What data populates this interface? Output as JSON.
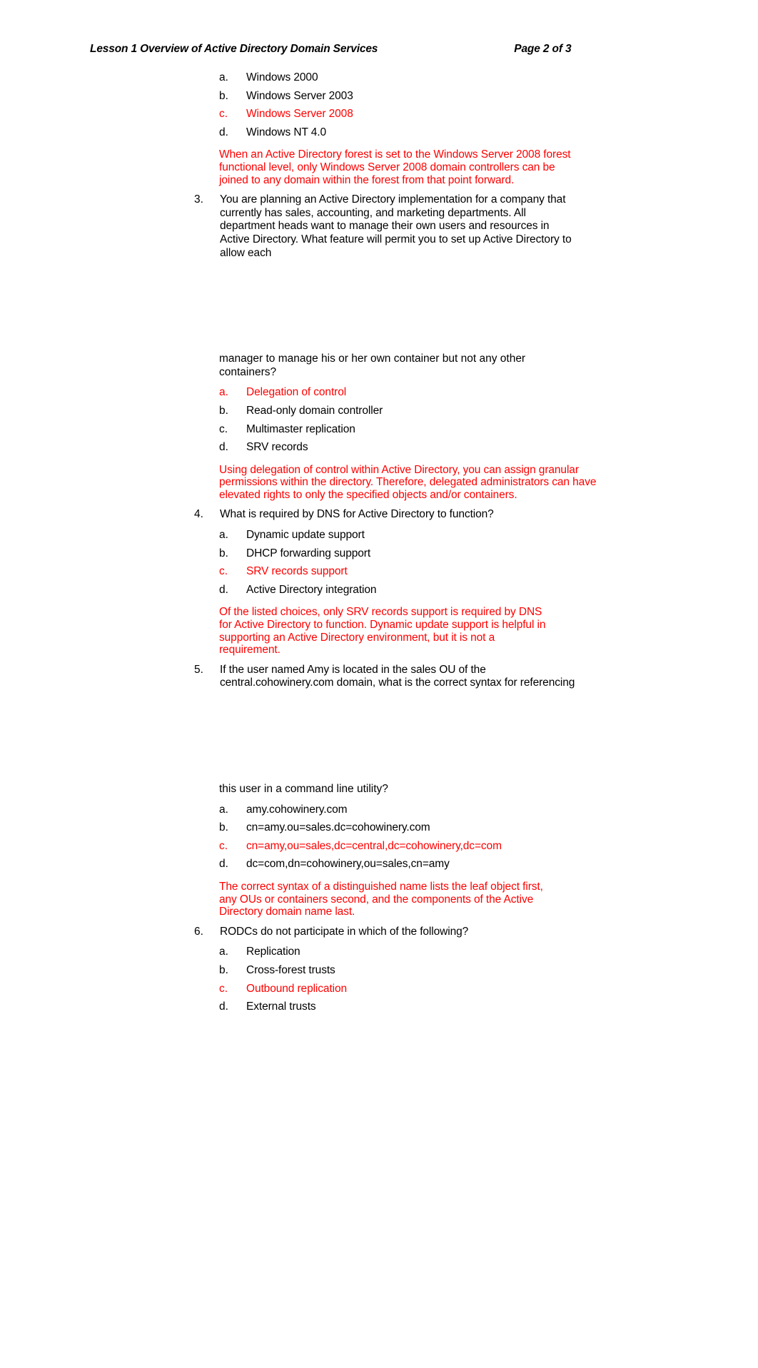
{
  "header": {
    "left": "Lesson 1 Overview of Active Directory Domain Services",
    "right": "Page 2 of 3"
  },
  "colors": {
    "correct_answer": "#ff0000",
    "body_text": "#000000",
    "page_background": "#ffffff"
  },
  "q2_continued": {
    "choices": [
      {
        "letter": "a.",
        "text": "Windows 2000",
        "correct": false
      },
      {
        "letter": "b.",
        "text": "Windows Server 2003",
        "correct": false
      },
      {
        "letter": "c.",
        "text": "Windows Server 2008",
        "correct": true
      },
      {
        "letter": "d.",
        "text": "Windows NT 4.0",
        "correct": false
      }
    ],
    "explanation": "When an Active Directory forest is set to the Windows Server 2008 forest functional level, only Windows Server 2008 domain controllers can be joined to any domain within the forest from that point forward."
  },
  "questions": [
    {
      "number": "3.",
      "text": "You are planning an Active Directory implementation for a company that currently has sales, accounting, and marketing departments. All department heads want to manage their own users and resources in Active Directory. What feature will permit you to set up Active Directory to allow each",
      "continuation": "manager to manage his or her own container but not any other containers?",
      "choices": [
        {
          "letter": "a.",
          "text": "Delegation of control",
          "correct": true
        },
        {
          "letter": "b.",
          "text": "Read-only domain controller",
          "correct": false
        },
        {
          "letter": "c.",
          "text": "Multimaster replication",
          "correct": false
        },
        {
          "letter": "d.",
          "text": "SRV records",
          "correct": false
        }
      ],
      "explanation": "Using delegation of control within Active Directory, you can assign granular permissions within the directory. Therefore, delegated administrators can have elevated rights to only the specified objects and/or containers."
    },
    {
      "number": "4.",
      "text": "What is required by DNS for Active Directory to function?",
      "continuation": "",
      "choices": [
        {
          "letter": "a.",
          "text": "Dynamic update support",
          "correct": false
        },
        {
          "letter": "b.",
          "text": "DHCP forwarding support",
          "correct": false
        },
        {
          "letter": "c.",
          "text": "SRV records support",
          "correct": true
        },
        {
          "letter": "d.",
          "text": "Active Directory integration",
          "correct": false
        }
      ],
      "explanation": "Of the listed choices, only SRV records support is required by DNS for Active Directory to function. Dynamic update support is helpful in supporting an Active Directory environment, but it is not a requirement."
    },
    {
      "number": "5.",
      "text": "If the user named Amy is located in the sales OU of the central.cohowinery.com domain, what is the correct syntax for referencing",
      "continuation": "this user in a command line utility?",
      "choices": [
        {
          "letter": "a.",
          "text": "amy.cohowinery.com",
          "correct": false
        },
        {
          "letter": "b.",
          "text": "cn=amy.ou=sales.dc=cohowinery.com",
          "correct": false
        },
        {
          "letter": "c.",
          "text": "cn=amy,ou=sales,dc=central,dc=cohowinery,dc=com",
          "correct": true
        },
        {
          "letter": "d.",
          "text": "dc=com,dn=cohowinery,ou=sales,cn=amy",
          "correct": false
        }
      ],
      "explanation": "The correct syntax of a distinguished name lists the leaf object first, any OUs or containers second, and the components of the Active Directory domain name last."
    },
    {
      "number": "6.",
      "text": "RODCs do not participate in which of the following?",
      "continuation": "",
      "choices": [
        {
          "letter": "a.",
          "text": "Replication",
          "correct": false
        },
        {
          "letter": "b.",
          "text": "Cross-forest trusts",
          "correct": false
        },
        {
          "letter": "c.",
          "text": "Outbound replication",
          "correct": true
        },
        {
          "letter": "d.",
          "text": "External trusts",
          "correct": false
        }
      ],
      "explanation": ""
    }
  ]
}
